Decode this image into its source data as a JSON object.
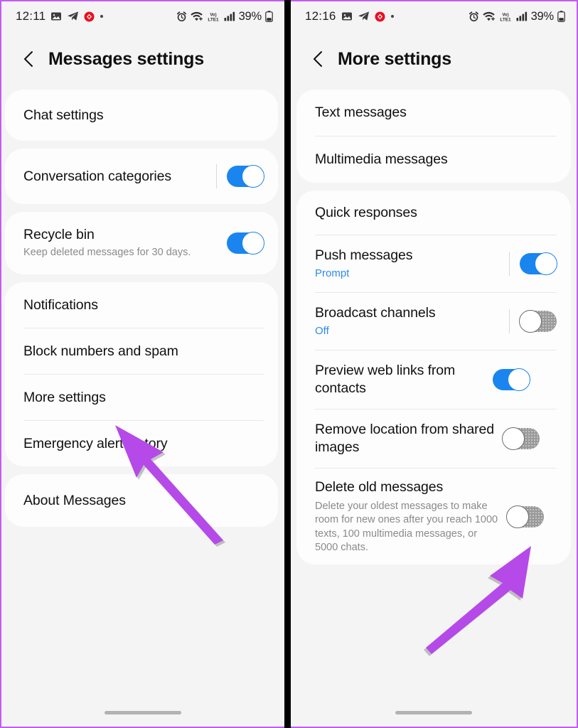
{
  "accent_colors": {
    "toggle_on": "#1a85ef",
    "toggle_off": "#9a9a9a",
    "link_text": "#2d8bf0",
    "arrow": "#b54ae8",
    "panel_border": "#c45cf0",
    "card_bg": "#fdfdfd",
    "page_bg": "#f4f4f4"
  },
  "left_panel": {
    "status_bar": {
      "time": "12:11",
      "battery_percent": "39%",
      "left_icons": [
        "photo-icon",
        "telegram-icon",
        "red-badge-icon",
        "dot-icon"
      ],
      "right_icons": [
        "alarm-icon",
        "wifi-icon",
        "volte-icon",
        "signal-icon",
        "battery-icon"
      ],
      "network_label": "VoLTE1"
    },
    "header": {
      "back_icon": "chevron-left-icon",
      "title": "Messages settings"
    },
    "cards": [
      {
        "rows": [
          {
            "label": "Chat settings",
            "sub": "",
            "toggle": null
          }
        ]
      },
      {
        "rows": [
          {
            "label": "Conversation categories",
            "sub": "",
            "toggle": "on",
            "separator": true
          }
        ]
      },
      {
        "rows": [
          {
            "label": "Recycle bin",
            "sub": "Keep deleted messages for 30 days.",
            "toggle": "on",
            "separator": false
          }
        ]
      },
      {
        "rows": [
          {
            "label": "Notifications",
            "sub": "",
            "toggle": null
          },
          {
            "label": "Block numbers and spam",
            "sub": "",
            "toggle": null
          },
          {
            "label": "More settings",
            "sub": "",
            "toggle": null
          },
          {
            "label": "Emergency alert history",
            "sub": "",
            "toggle": null
          }
        ]
      },
      {
        "rows": [
          {
            "label": "About Messages",
            "sub": "",
            "toggle": null
          }
        ]
      }
    ],
    "gesture_bar": "home-indicator",
    "annotation": {
      "name": "arrow-pointing-to-more-settings",
      "direction": "up-left"
    }
  },
  "right_panel": {
    "status_bar": {
      "time": "12:16",
      "battery_percent": "39%",
      "left_icons": [
        "photo-icon",
        "telegram-icon",
        "red-badge-icon",
        "dot-icon"
      ],
      "right_icons": [
        "alarm-icon",
        "wifi-icon",
        "volte-icon",
        "signal-icon",
        "battery-icon"
      ],
      "network_label": "VoLTE1"
    },
    "header": {
      "back_icon": "chevron-left-icon",
      "title": "More settings"
    },
    "cards": [
      {
        "rows": [
          {
            "label": "Text messages",
            "sub": "",
            "toggle": null
          },
          {
            "label": "Multimedia messages",
            "sub": "",
            "toggle": null
          }
        ]
      },
      {
        "rows": [
          {
            "label": "Quick responses",
            "sub": "",
            "toggle": null
          },
          {
            "label": "Push messages",
            "sub": "Prompt",
            "sub_style": "blue",
            "toggle": "on",
            "separator": true
          },
          {
            "label": "Broadcast channels",
            "sub": "Off",
            "sub_style": "blue",
            "toggle": "off",
            "separator": true
          },
          {
            "label": "Preview web links from contacts",
            "sub": "",
            "toggle": "on",
            "separator": false
          },
          {
            "label": "Remove location from shared images",
            "sub": "",
            "toggle": "off",
            "separator": false
          },
          {
            "label": "Delete old messages",
            "sub": "Delete your oldest messages to make room for new ones after you reach 1000 texts, 100 multimedia messages, or 5000 chats.",
            "toggle": "off",
            "separator": false
          }
        ]
      }
    ],
    "gesture_bar": "home-indicator",
    "annotation": {
      "name": "arrow-pointing-to-delete-old-messages-toggle",
      "direction": "up-right"
    }
  }
}
